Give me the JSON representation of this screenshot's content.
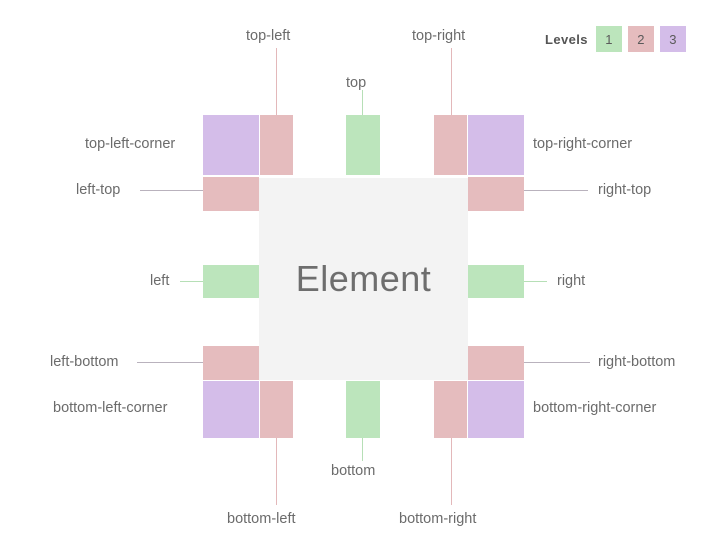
{
  "legend": {
    "title": "Levels",
    "items": [
      {
        "label": "1",
        "color": "#bce5bc"
      },
      {
        "label": "2",
        "color": "#e5bcbe"
      },
      {
        "label": "3",
        "color": "#d4bde9"
      }
    ]
  },
  "element": {
    "label": "Element"
  },
  "labels": {
    "top_left": "top-left",
    "top": "top",
    "top_right": "top-right",
    "top_left_corner": "top-left-corner",
    "top_right_corner": "top-right-corner",
    "left_top": "left-top",
    "right_top": "right-top",
    "left": "left",
    "right": "right",
    "left_bottom": "left-bottom",
    "right_bottom": "right-bottom",
    "bottom_left_corner": "bottom-left-corner",
    "bottom_right_corner": "bottom-right-corner",
    "bottom": "bottom",
    "bottom_left": "bottom-left",
    "bottom_right": "bottom-right"
  },
  "colors": {
    "level1_green": "#bce5bc",
    "level2_pink": "#e5bcbe",
    "level3_purple": "#d4bde9",
    "element_bg": "#f3f3f3",
    "text": "#6b6b6b",
    "background": "#ffffff"
  }
}
